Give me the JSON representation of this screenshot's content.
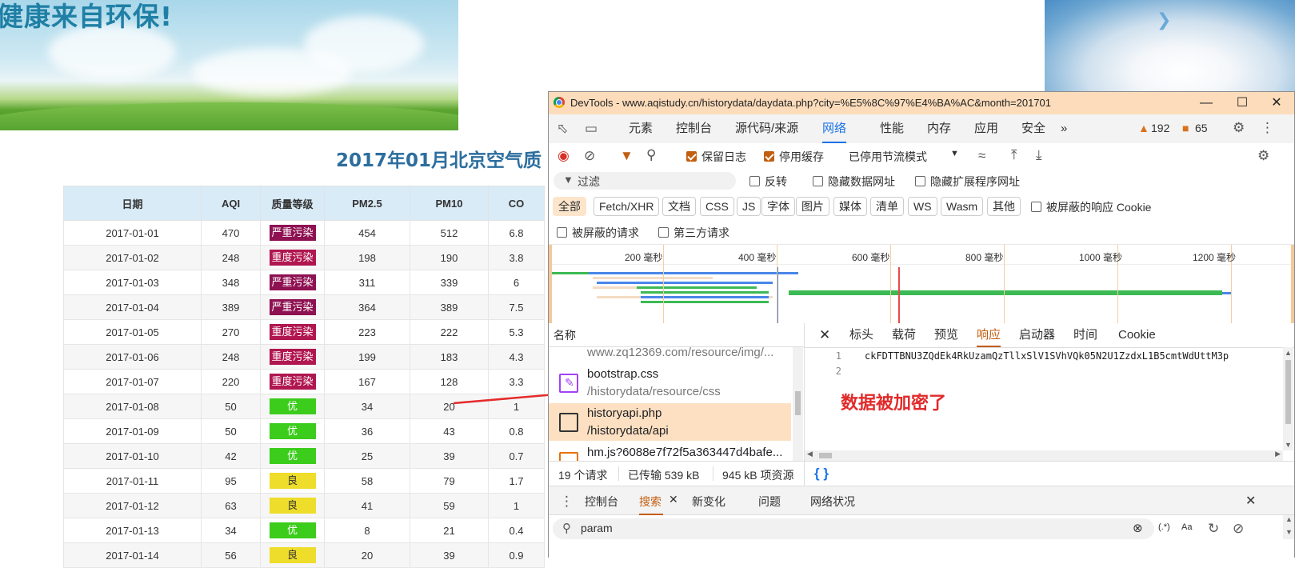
{
  "banner": {
    "title": "健康来自环保!"
  },
  "page": {
    "heading": "2017年01月北京空气质"
  },
  "table": {
    "headers": [
      "日期",
      "AQI",
      "质量等级",
      "PM2.5",
      "PM10",
      "CO"
    ],
    "rows": [
      {
        "date": "2017-01-01",
        "aqi": "470",
        "level": "严重污染",
        "pm25": "454",
        "pm10": "512",
        "co": "6.8"
      },
      {
        "date": "2017-01-02",
        "aqi": "248",
        "level": "重度污染",
        "pm25": "198",
        "pm10": "190",
        "co": "3.8"
      },
      {
        "date": "2017-01-03",
        "aqi": "348",
        "level": "严重污染",
        "pm25": "311",
        "pm10": "339",
        "co": "6"
      },
      {
        "date": "2017-01-04",
        "aqi": "389",
        "level": "严重污染",
        "pm25": "364",
        "pm10": "389",
        "co": "7.5"
      },
      {
        "date": "2017-01-05",
        "aqi": "270",
        "level": "重度污染",
        "pm25": "223",
        "pm10": "222",
        "co": "5.3"
      },
      {
        "date": "2017-01-06",
        "aqi": "248",
        "level": "重度污染",
        "pm25": "199",
        "pm10": "183",
        "co": "4.3"
      },
      {
        "date": "2017-01-07",
        "aqi": "220",
        "level": "重度污染",
        "pm25": "167",
        "pm10": "128",
        "co": "3.3"
      },
      {
        "date": "2017-01-08",
        "aqi": "50",
        "level": "优",
        "pm25": "34",
        "pm10": "20",
        "co": "1"
      },
      {
        "date": "2017-01-09",
        "aqi": "50",
        "level": "优",
        "pm25": "36",
        "pm10": "43",
        "co": "0.8"
      },
      {
        "date": "2017-01-10",
        "aqi": "42",
        "level": "优",
        "pm25": "25",
        "pm10": "39",
        "co": "0.7"
      },
      {
        "date": "2017-01-11",
        "aqi": "95",
        "level": "良",
        "pm25": "58",
        "pm10": "79",
        "co": "1.7"
      },
      {
        "date": "2017-01-12",
        "aqi": "63",
        "level": "良",
        "pm25": "41",
        "pm10": "59",
        "co": "1"
      },
      {
        "date": "2017-01-13",
        "aqi": "34",
        "level": "优",
        "pm25": "8",
        "pm10": "21",
        "co": "0.4"
      },
      {
        "date": "2017-01-14",
        "aqi": "56",
        "level": "良",
        "pm25": "20",
        "pm10": "39",
        "co": "0.9"
      }
    ],
    "level_colors": {
      "严重污染": "#8e1152",
      "重度污染": "#b0164f",
      "优": "#3ccc1c",
      "良": "#eedd2a"
    }
  },
  "devtools": {
    "title": "DevTools - www.aqistudy.cn/historydata/daydata.php?city=%E5%8C%97%E4%BA%AC&month=201701",
    "tabs": [
      "元素",
      "控制台",
      "源代码/来源",
      "网络",
      "性能",
      "内存",
      "应用",
      "安全"
    ],
    "active_tab": "网络",
    "warnings": "192",
    "errors": "65",
    "toolbar": {
      "preserve_log": "保留日志",
      "disable_cache": "停用缓存",
      "throttle": "已停用节流模式"
    },
    "filter": {
      "placeholder": "过滤",
      "invert": "反转",
      "hide_data_urls": "隐藏数据网址",
      "hide_ext_urls": "隐藏扩展程序网址"
    },
    "type_chips": [
      "全部",
      "Fetch/XHR",
      "文档",
      "CSS",
      "JS",
      "字体",
      "图片",
      "媒体",
      "清单",
      "WS",
      "Wasm",
      "其他"
    ],
    "blocked_cookies": "被屏蔽的响应 Cookie",
    "blocked_requests": "被屏蔽的请求",
    "third_party": "第三方请求",
    "timeline_ticks": [
      "200 毫秒",
      "400 毫秒",
      "600 毫秒",
      "800 毫秒",
      "1000 毫秒",
      "1200 毫秒"
    ],
    "name_header": "名称",
    "requests": [
      {
        "name": "",
        "path": "www.zq12369.com/resource/img/..."
      },
      {
        "name": "bootstrap.css",
        "path": "/historydata/resource/css"
      },
      {
        "name": "historyapi.php",
        "path": "/historydata/api"
      },
      {
        "name": "hm.js?6088e7f72f5a363447d4bafe...",
        "path": ""
      }
    ],
    "detail_tabs": [
      "标头",
      "载荷",
      "预览",
      "响应",
      "启动器",
      "时间",
      "Cookie"
    ],
    "active_detail_tab": "响应",
    "response_lines": [
      "ckFDTTBNU3ZQdEk4RkUzamQzTllxSlV1SVhVQk05N2U1ZzdxL1B5cmtWdUttM3p",
      ""
    ],
    "annotation": "数据被加密了",
    "status": {
      "requests": "19 个请求",
      "transferred": "已传输 539 kB",
      "resources": "945 kB 项资源"
    },
    "drawer_tabs": [
      "控制台",
      "搜索",
      "新变化",
      "问题",
      "网络状况"
    ],
    "search_query": "param",
    "search_opts": {
      "regex": "(.*)",
      "case": "Aa"
    }
  }
}
